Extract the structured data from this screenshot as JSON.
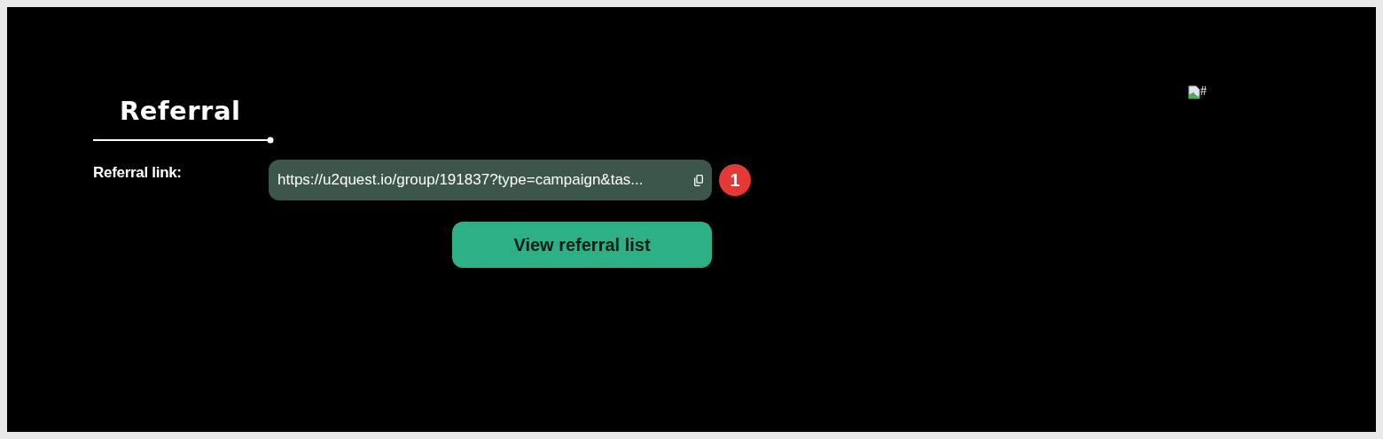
{
  "section": {
    "title": "Referral"
  },
  "referral_link": {
    "label": "Referral link:",
    "value": "https://u2quest.io/group/191837?type=campaign&tas...",
    "badge": "1"
  },
  "button": {
    "label": "View referral list"
  },
  "broken_image": {
    "alt": "#"
  }
}
